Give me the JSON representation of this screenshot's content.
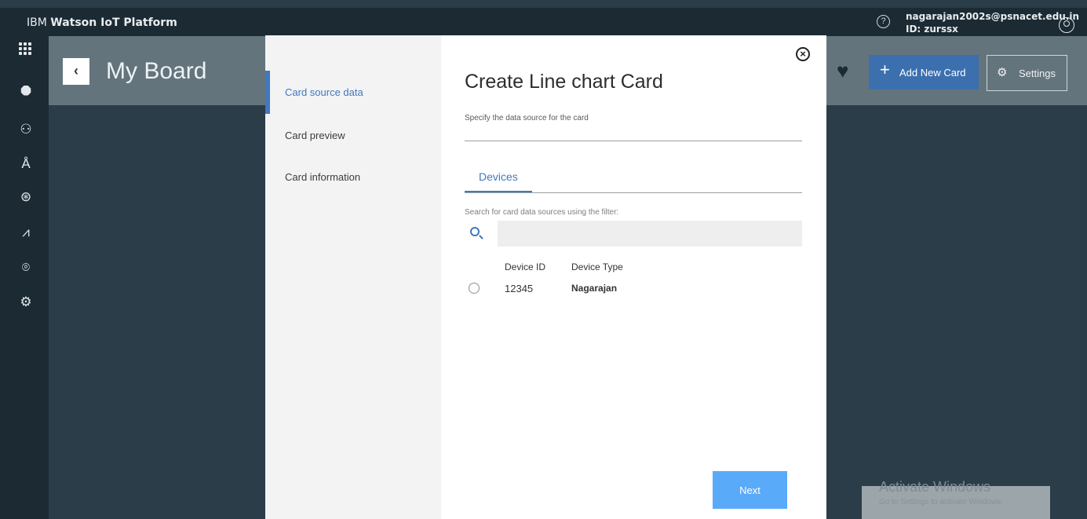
{
  "topbar": {
    "brand_light": "IBM ",
    "brand_bold": "Watson IoT Platform",
    "help_icon": "?",
    "user_email": "nagarajan2002s@psnacet.edu.in",
    "user_id": "ID: zurssx"
  },
  "board": {
    "back_icon": "‹",
    "title": "My Board",
    "add_card_label": "Add New Card",
    "settings_label": "Settings"
  },
  "modal": {
    "steps": [
      "Card source data",
      "Card preview",
      "Card information"
    ],
    "active_step": "Card source data",
    "title": "Create Line chart Card",
    "subtitle": "Specify the data source for the card",
    "tab_label": "Devices",
    "filter_label": "Search for card data sources using the filter:",
    "search_value": "",
    "columns": [
      "Device ID",
      "Device Type"
    ],
    "rows": [
      {
        "device_id": "12345",
        "device_type": "Nagarajan"
      }
    ],
    "next_label": "Next"
  },
  "watermark": {
    "line1": "Activate Windows",
    "line2": "Go to Settings to activate Windows."
  },
  "colors": {
    "accent": "#4178be",
    "next_button": "#5aaafa",
    "nav_dark": "#1c2a33",
    "background": "#2a3d48"
  }
}
